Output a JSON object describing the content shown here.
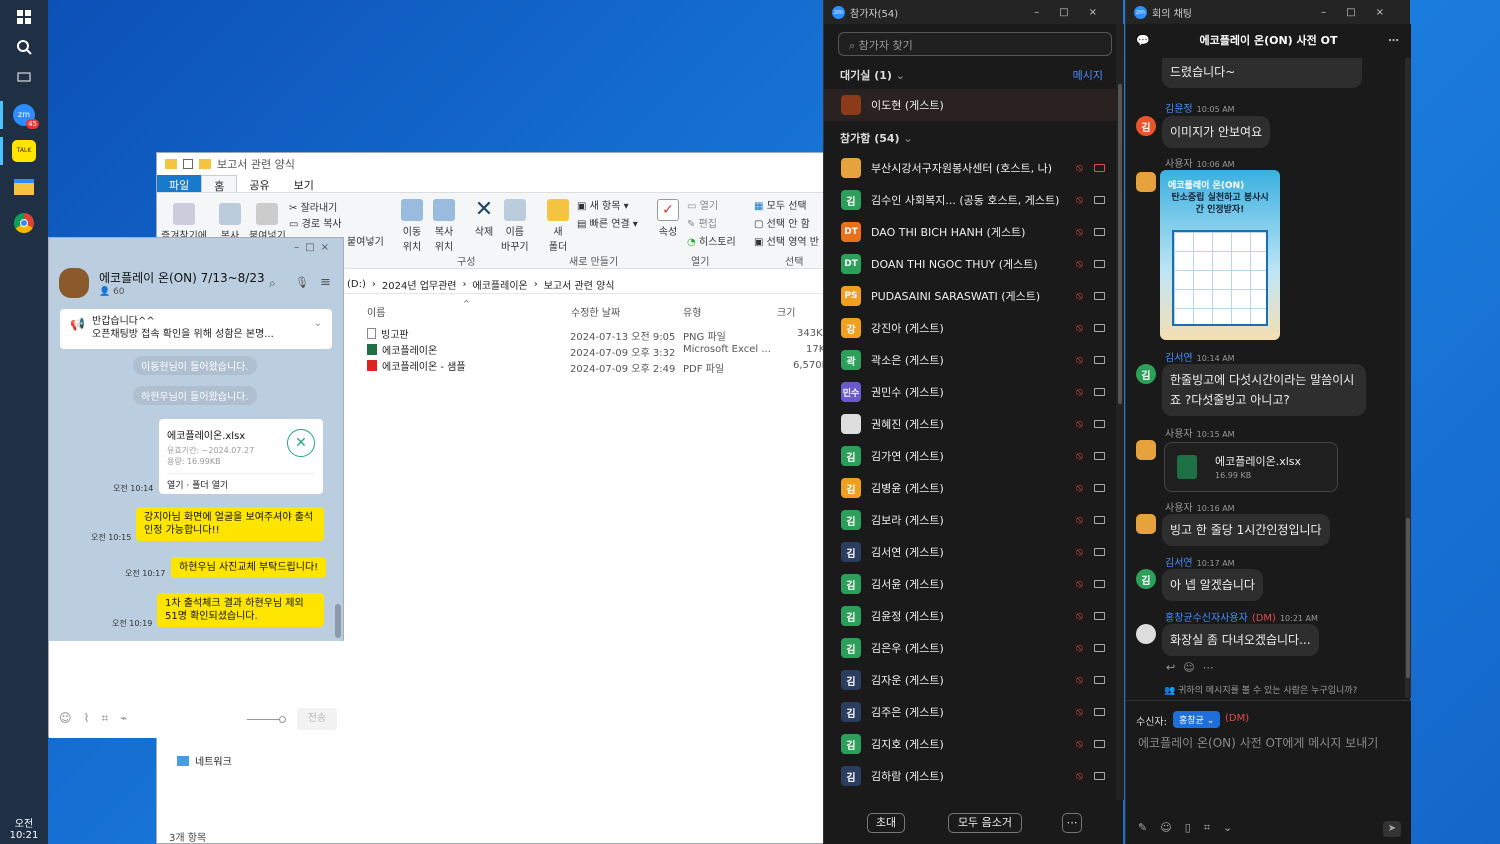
{
  "taskbar": {
    "clock": "오전 10:21",
    "zoom_badge": "45"
  },
  "explorer": {
    "title": "보고서 관련 양식",
    "tabs": [
      "파일",
      "홈",
      "공유",
      "보기"
    ],
    "ribbon": {
      "pin": "즐겨찾기에",
      "copy": "복사",
      "paste": "붙여넣기",
      "cut": "잘라내기",
      "copy_path": "경로 복사",
      "paste_shortcut": "붙여넣기",
      "move": "이동\n위치",
      "copy_to": "복사\n위치",
      "delete": "삭제",
      "rename": "이름\n바꾸기",
      "new_folder": "새\n폴더",
      "new_item": "새 항목",
      "easy_access": "빠른 연결",
      "properties": "속성",
      "open": "열기",
      "edit": "편집",
      "history": "히스토리",
      "select_all": "모두 선택",
      "select_none": "선택 안 함",
      "invert": "선택 영역 반",
      "group_organize": "구성",
      "group_new": "새로 만들기",
      "group_open": "열기",
      "group_select": "선택"
    },
    "address": [
      "(D:)",
      "2024년 업무관련",
      "에코플레이온",
      "보고서 관련 양식"
    ],
    "columns": {
      "name": "이름",
      "date": "수정한 날짜",
      "type": "유형",
      "size": "크기"
    },
    "files": [
      {
        "name": "빙고판",
        "date": "2024-07-13 오전 9:05",
        "type": "PNG 파일",
        "size": "343K"
      },
      {
        "name": "에코플레이온",
        "date": "2024-07-09 오후 3:32",
        "type": "Microsoft Excel ...",
        "size": "17K"
      },
      {
        "name": "에코플레이온 - 샘플",
        "date": "2024-07-09 오후 2:49",
        "type": "PDF 파일",
        "size": "6,570K"
      }
    ],
    "nav_network": "네트워크",
    "status": "3개 항목"
  },
  "kakao": {
    "title": "에코플레이 온(ON) 7/13~8/23",
    "members": "60",
    "notice_line1": "반갑습니다^^",
    "notice_line2": "오픈채팅방 접속 확인을 위해 성함은 본명...",
    "sys1": "이동현님이 들어왔습니다.",
    "sys2": "하현우님이 들어왔습니다.",
    "file_name": "에코플레이온.xlsx",
    "file_exp": "유효기간: ~2024.07.27",
    "file_size": "용량: 16.99KB",
    "file_actions": "열기 · 폴더 열기",
    "file_time": "오전 10:14",
    "msg1": "강지아님 화면에 얼굴을 보여주셔야 출석 인정 가능합니다!!",
    "msg1_time": "오전 10:15",
    "msg2": "하현우님 사진교체 부탁드립니다!",
    "msg2_time": "오전 10:17",
    "msg3": "1차 출석체크 결과 하현우님 제외 51명 확인되셨습니다.",
    "msg3_time": "오전 10:19",
    "send": "전송"
  },
  "participants": {
    "title": "참가자(54)",
    "search_placeholder": "참가자 찾기",
    "waiting": "대기실 (1)",
    "message_all": "메시지",
    "waiting_person": "이도현 (게스트)",
    "joined": "참가함 (54)",
    "list": [
      {
        "name": "부산시강서구자원봉사센터 (호스트, 나)",
        "av": "",
        "color": "#e6a23c"
      },
      {
        "name": "김수인 사회복지... (공동 호스트, 게스트)",
        "av": "김",
        "color": "#2ca05a"
      },
      {
        "name": "DAO THI BICH HANH (게스트)",
        "av": "DT",
        "color": "#e8711a"
      },
      {
        "name": "DOAN THI NGOC THUY (게스트)",
        "av": "DT",
        "color": "#2ca05a"
      },
      {
        "name": "PUDASAINI SARASWATI  (게스트)",
        "av": "PS",
        "color": "#f0a020"
      },
      {
        "name": "강진아 (게스트)",
        "av": "강",
        "color": "#f0a020"
      },
      {
        "name": "곽소은 (게스트)",
        "av": "곽",
        "color": "#2ca05a"
      },
      {
        "name": "권민수 (게스트)",
        "av": "민수",
        "color": "#6a5acd"
      },
      {
        "name": "권혜진 (게스트)",
        "av": "",
        "color": "#dddddd"
      },
      {
        "name": "김가연 (게스트)",
        "av": "김",
        "color": "#2ca05a"
      },
      {
        "name": "김병윤 (게스트)",
        "av": "김",
        "color": "#f0a020"
      },
      {
        "name": "김보라 (게스트)",
        "av": "김",
        "color": "#2ca05a"
      },
      {
        "name": "김서연 (게스트)",
        "av": "김",
        "color": "#2c3e60"
      },
      {
        "name": "김서윤 (게스트)",
        "av": "김",
        "color": "#2ca05a"
      },
      {
        "name": "김윤정 (게스트)",
        "av": "김",
        "color": "#2ca05a"
      },
      {
        "name": "김은우 (게스트)",
        "av": "김",
        "color": "#2ca05a"
      },
      {
        "name": "김자운 (게스트)",
        "av": "김",
        "color": "#2c3e60"
      },
      {
        "name": "김주은 (게스트)",
        "av": "김",
        "color": "#2c3e60"
      },
      {
        "name": "김지호 (게스트)",
        "av": "김",
        "color": "#2ca05a"
      },
      {
        "name": "김하람 (게스트)",
        "av": "김",
        "color": "#2c3e60"
      }
    ],
    "invite": "초대",
    "mute_all": "모두 음소거"
  },
  "chat": {
    "window_title": "회의 채팅",
    "header": "에코플레이 온(ON) 사전 OT",
    "top_bubble": "드렸습니다~",
    "m1_sender": "김윤정",
    "m1_time": "10:05 AM",
    "m1_text": "이미지가 안보여요",
    "m2_sender": "사용자",
    "m2_time": "10:06 AM",
    "img_title": "에코플레이 온(ON)",
    "img_sub": "탄소중립 실천하고 봉사시간 인정받자!",
    "m3_sender": "김서연",
    "m3_time": "10:14 AM",
    "m3_text": "한줄빙고에 다섯시간이라는 말씀이시죠 ?다섯줄빙고 아니고?",
    "m4_sender": "사용자",
    "m4_time": "10:15 AM",
    "m4_file": "에코플레이온.xlsx",
    "m4_size": "16.99 KB",
    "m5_sender": "사용자",
    "m5_time": "10:16 AM",
    "m5_text": "빙고 한 줄당 1시간인정입니다",
    "m6_sender": "김서연",
    "m6_time": "10:17 AM",
    "m6_text": "아 넵 알겠습니다",
    "m7_sender": "홍창균수신자사용자",
    "m7_dm": "(DM)",
    "m7_time": "10:21 AM",
    "m7_text": "화장실 좀 다녀오겠습니다...",
    "who_sees": "귀하의 메시지를 볼 수 있는 사람은 누구입니까?",
    "to_label": "수신자:",
    "to_name": "홍창균",
    "to_dm": "(DM)",
    "input_placeholder": "에코플레이 온(ON) 사전 OT에게 메시지 보내기"
  }
}
